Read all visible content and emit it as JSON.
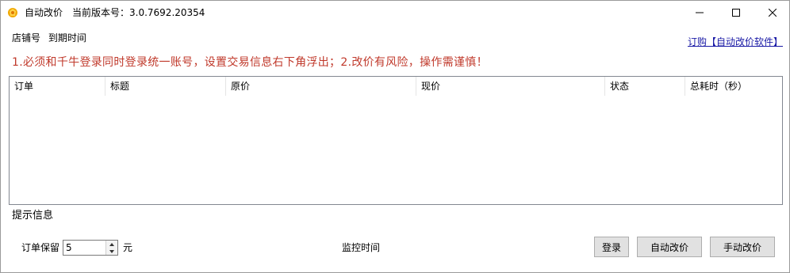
{
  "window": {
    "title": "自动改价",
    "version_label": "当前版本号：3.0.7692.20354"
  },
  "header": {
    "store_label": "店铺号",
    "expiry_label": "到期时间",
    "buy_link": "订购【自动改价软件】"
  },
  "notice": "1.必须和千牛登录同时登录统一账号，设置交易信息右下角浮出；2.改价有风险，操作需谨慎！",
  "table": {
    "columns": [
      "订单",
      "标题",
      "原价",
      "现价",
      "状态",
      "总耗时（秒）"
    ],
    "rows": []
  },
  "hint_label": "提示信息",
  "footer": {
    "keep_label": "订单保留",
    "keep_value": "5",
    "unit": "元",
    "monitor_label": "监控时间",
    "login_button": "登录",
    "auto_button": "自动改价",
    "manual_button": "手动改价"
  },
  "colors": {
    "notice": "#c0392b",
    "link": "#1a1aa6"
  }
}
